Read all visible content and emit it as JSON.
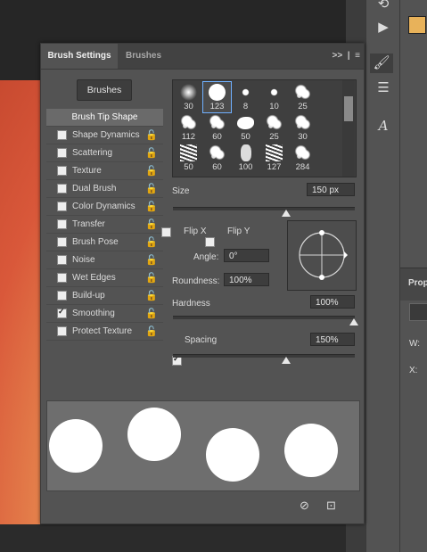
{
  "panel": {
    "tabs": [
      {
        "label": "Brush Settings"
      },
      {
        "label": "Brushes"
      }
    ],
    "menu_icons": ">>",
    "brushes_button": "Brushes",
    "list": [
      {
        "label": "Brush Tip Shape",
        "checked": null,
        "active": true,
        "lock": false
      },
      {
        "label": "Shape Dynamics",
        "checked": false,
        "lock": true
      },
      {
        "label": "Scattering",
        "checked": false,
        "lock": true
      },
      {
        "label": "Texture",
        "checked": false,
        "lock": true
      },
      {
        "label": "Dual Brush",
        "checked": false,
        "lock": true
      },
      {
        "label": "Color Dynamics",
        "checked": false,
        "lock": true
      },
      {
        "label": "Transfer",
        "checked": false,
        "lock": true
      },
      {
        "label": "Brush Pose",
        "checked": false,
        "lock": true
      },
      {
        "label": "Noise",
        "checked": false,
        "lock": true
      },
      {
        "label": "Wet Edges",
        "checked": false,
        "lock": true
      },
      {
        "label": "Build-up",
        "checked": false,
        "lock": true
      },
      {
        "label": "Smoothing",
        "checked": true,
        "lock": true
      },
      {
        "label": "Protect Texture",
        "checked": false,
        "lock": true
      }
    ],
    "brush_sizes": [
      "30",
      "123",
      "8",
      "10",
      "25",
      "112",
      "60",
      "50",
      "25",
      "30",
      "50",
      "60",
      "100",
      "127",
      "284"
    ],
    "selected_brush": 1,
    "size_label": "Size",
    "size_value": "150 px",
    "flip_x": "Flip X",
    "flip_y": "Flip Y",
    "angle_label": "Angle:",
    "angle_value": "0°",
    "roundness_label": "Roundness:",
    "roundness_value": "100%",
    "hardness_label": "Hardness",
    "hardness_value": "100%",
    "spacing_label": "Spacing",
    "spacing_checked": true,
    "spacing_value": "150%"
  },
  "right_panel": {
    "label": "Prop",
    "w_label": "W:",
    "x_label": "X:"
  },
  "colors": {
    "foreground_swatch": "#e8b25a",
    "selection_outline": "#6fb0ff"
  }
}
